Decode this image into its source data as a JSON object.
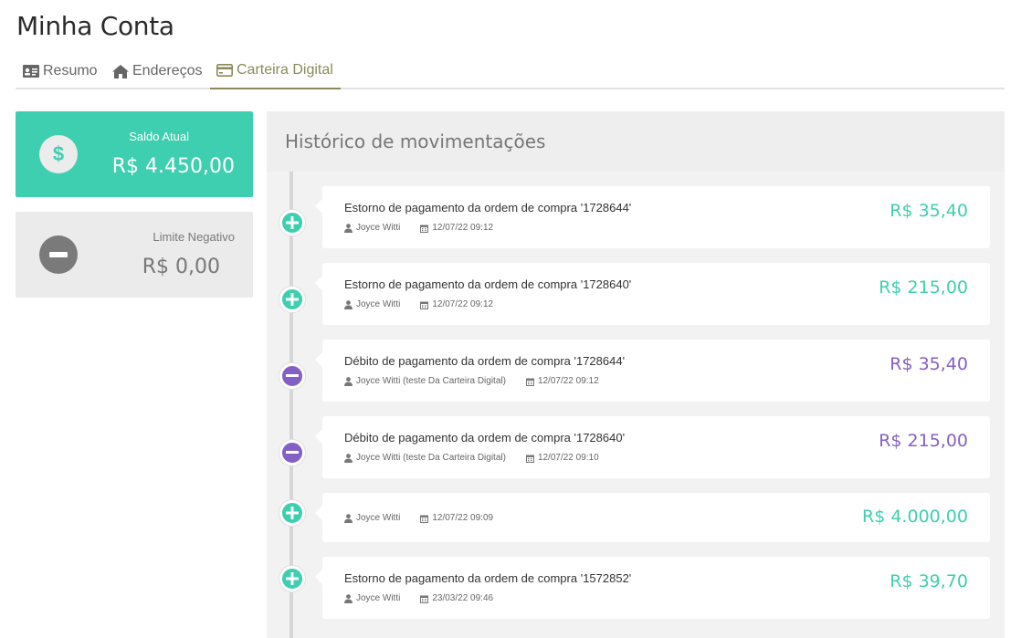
{
  "page": {
    "title": "Minha Conta"
  },
  "tabs": [
    {
      "label": "Resumo",
      "icon": "id-card-icon"
    },
    {
      "label": "Endereços",
      "icon": "home-icon"
    },
    {
      "label": "Carteira Digital",
      "icon": "credit-card-icon",
      "active": true
    }
  ],
  "balance": {
    "label": "Saldo Atual",
    "amount": "R$ 4.450,00",
    "icon": "dollar-icon",
    "color": "#3ecfb0"
  },
  "limit": {
    "label": "Limite Negativo",
    "amount": "R$ 0,00",
    "icon": "minus-icon"
  },
  "history": {
    "title": "Histórico de movimentações",
    "entries": [
      {
        "type": "credit",
        "description": "Estorno de pagamento da ordem de compra '1728644'",
        "user": "Joyce Witti",
        "date": "12/07/22 09:12",
        "amount": "R$ 35,40"
      },
      {
        "type": "credit",
        "description": "Estorno de pagamento da ordem de compra '1728640'",
        "user": "Joyce Witti",
        "date": "12/07/22 09:12",
        "amount": "R$ 215,00"
      },
      {
        "type": "debit",
        "description": "Débito de pagamento da ordem de compra '1728644'",
        "user": "Joyce Witti (teste Da Carteira Digital)",
        "date": "12/07/22 09:12",
        "amount": "R$ 35,40"
      },
      {
        "type": "debit",
        "description": "Débito de pagamento da ordem de compra '1728640'",
        "user": "Joyce Witti (teste Da Carteira Digital)",
        "date": "12/07/22 09:10",
        "amount": "R$ 215,00"
      },
      {
        "type": "credit",
        "description": "",
        "user": "Joyce Witti",
        "date": "12/07/22 09:09",
        "amount": "R$ 4.000,00"
      },
      {
        "type": "credit",
        "description": "Estorno de pagamento da ordem de compra '1572852'",
        "user": "Joyce Witti",
        "date": "23/03/22 09:46",
        "amount": "R$ 39,70"
      }
    ]
  },
  "colors": {
    "credit": "#3ecfb0",
    "debit": "#8560c4",
    "active_tab": "#8a8a5a"
  }
}
